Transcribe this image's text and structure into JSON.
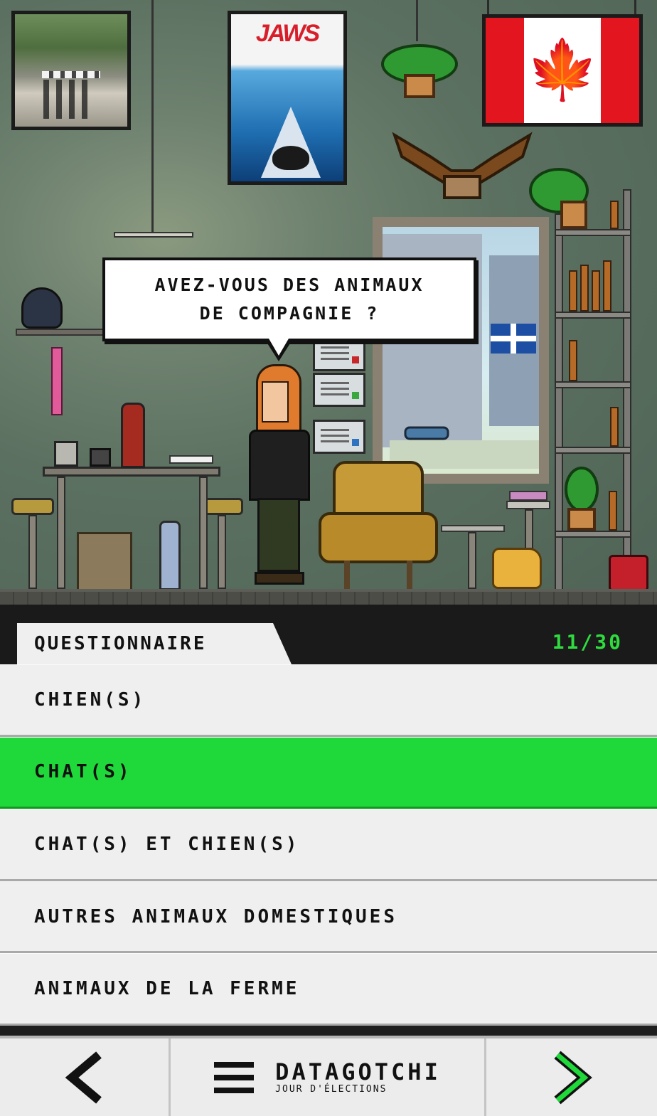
{
  "scene": {
    "poster_title": "JAWS",
    "bubble_line1": "AVEZ-VOUS DES ANIMAUX",
    "bubble_line2": "DE COMPAGNIE ?"
  },
  "quiz": {
    "tab_label": "QUESTIONNAIRE",
    "progress": "11/30",
    "options": [
      {
        "label": "CHIEN(S)",
        "selected": false
      },
      {
        "label": "CHAT(S)",
        "selected": true
      },
      {
        "label": "CHAT(S) ET CHIEN(S)",
        "selected": false
      },
      {
        "label": "AUTRES ANIMAUX DOMESTIQUES",
        "selected": false
      },
      {
        "label": "ANIMAUX DE LA FERME",
        "selected": false
      }
    ]
  },
  "nav": {
    "prev_icon": "chevron-left-icon",
    "next_icon": "chevron-right-icon",
    "menu_icon": "hamburger-menu-icon",
    "brand_name": "DATAGOTCHI",
    "brand_sub": "JOUR D'ÉLECTIONS"
  },
  "colors": {
    "selected": "#1fd93a",
    "progress": "#2fdc3e",
    "next_chevron": "#1fd93a"
  }
}
